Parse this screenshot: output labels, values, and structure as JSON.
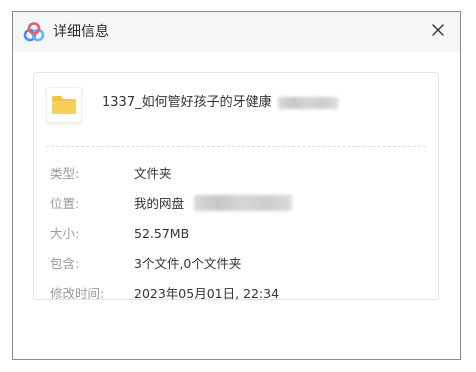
{
  "dialog": {
    "title": "详细信息",
    "close_glyph": "✕"
  },
  "file": {
    "name": "1337_如何管好孩子的牙健康",
    "icon": "folder-icon"
  },
  "details": [
    {
      "label": "类型:",
      "value": "文件夹"
    },
    {
      "label": "位置:",
      "value": "我的网盘"
    },
    {
      "label": "大小:",
      "value": "52.57MB"
    },
    {
      "label": "包含:",
      "value": "3个文件,0个文件夹"
    },
    {
      "label": "修改时间:",
      "value": "2023年05月01日, 22:34"
    }
  ],
  "colors": {
    "folder": "#f5c542",
    "logo_blue": "#4a8cf7",
    "titlebar": "#f5f6f8"
  }
}
